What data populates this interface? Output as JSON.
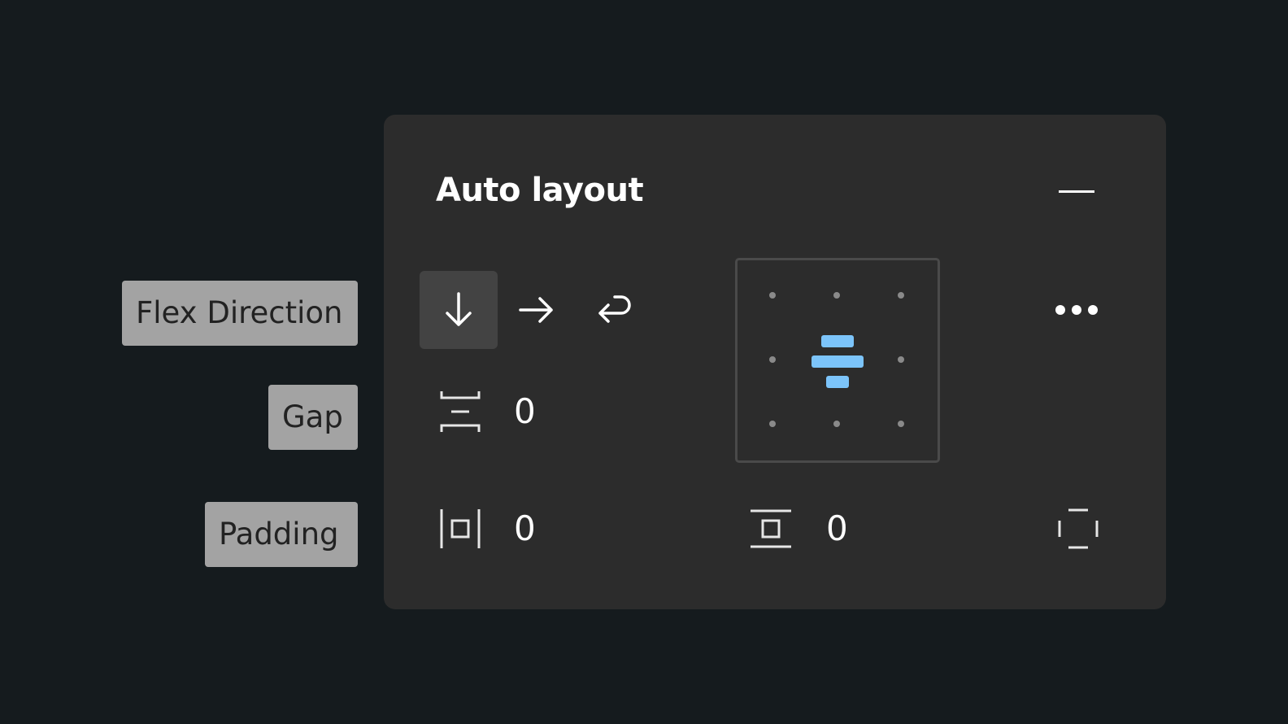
{
  "annotations": {
    "flex_direction": "Flex Direction",
    "gap": "Gap",
    "padding": "Padding"
  },
  "panel": {
    "title": "Auto layout",
    "gap_value": "0",
    "padding_horizontal_value": "0",
    "padding_vertical_value": "0",
    "direction_selected": "vertical",
    "alignment_selected": "center",
    "icons": {
      "collapse": "minus-icon",
      "direction_vertical": "arrow-down-icon",
      "direction_horizontal": "arrow-right-icon",
      "direction_wrap": "wrap-icon",
      "gap": "vertical-gap-icon",
      "padding_horizontal": "horizontal-padding-icon",
      "padding_vertical": "vertical-padding-icon",
      "padding_individual": "individual-padding-icon",
      "more": "ellipsis-icon"
    }
  },
  "colors": {
    "background": "#151b1e",
    "panel": "#2c2c2c",
    "active_button": "#434343",
    "accent": "#7cc4fa",
    "annotation_bg": "#a3a3a3"
  }
}
